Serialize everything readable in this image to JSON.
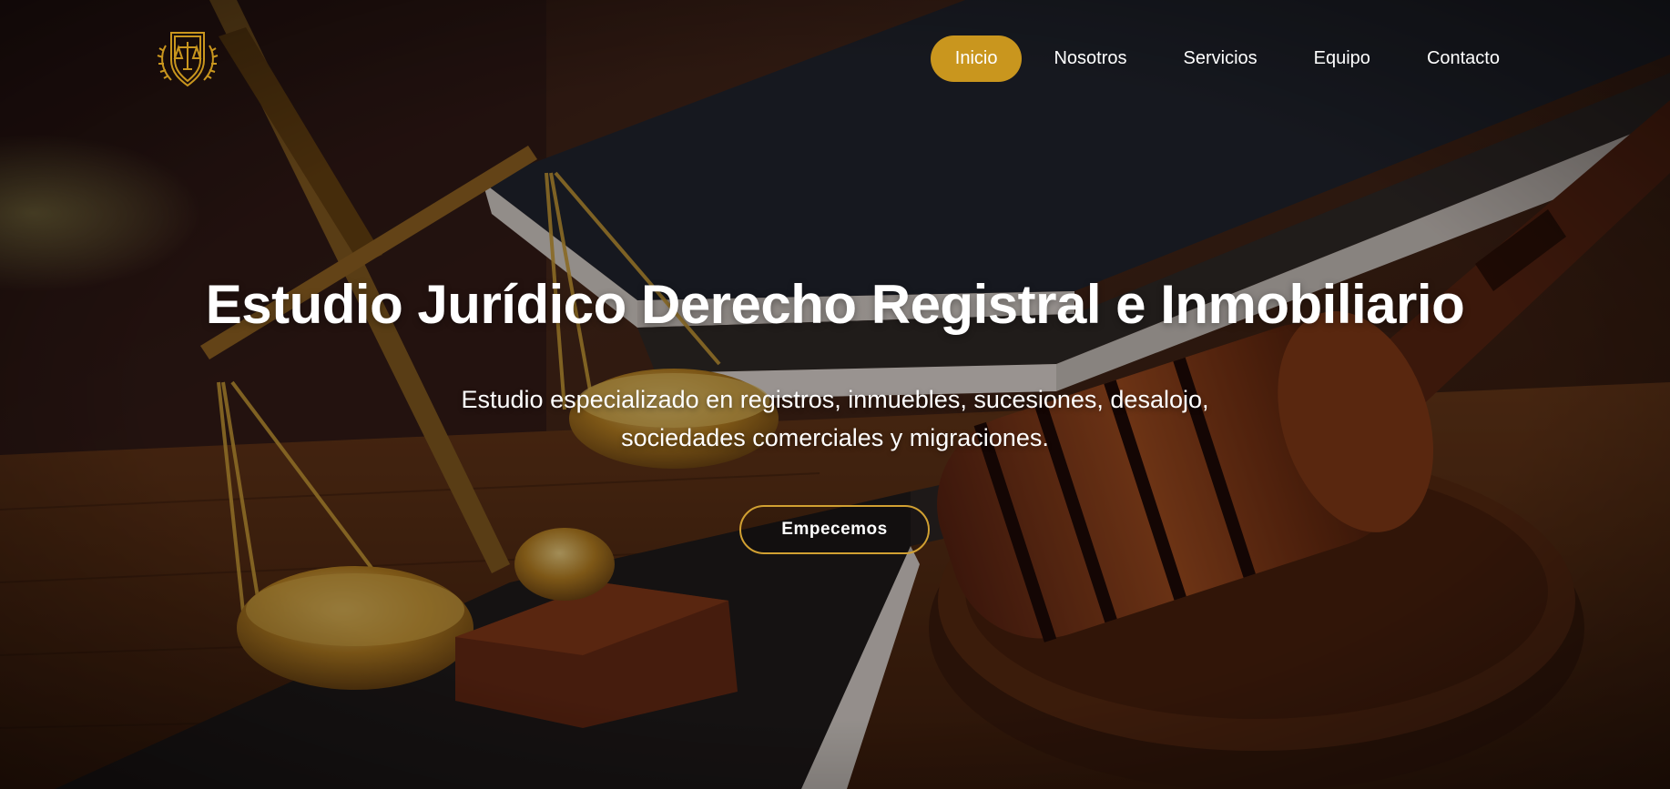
{
  "brand": {
    "logo_icon": "scales-of-justice-shield-icon",
    "accent_color": "#c9961e"
  },
  "nav": {
    "items": [
      {
        "label": "Inicio",
        "active": true
      },
      {
        "label": "Nosotros",
        "active": false
      },
      {
        "label": "Servicios",
        "active": false
      },
      {
        "label": "Equipo",
        "active": false
      },
      {
        "label": "Contacto",
        "active": false
      }
    ]
  },
  "hero": {
    "title": "Estudio Jurídico Derecho Registral e Inmobiliario",
    "subtitle_line1": "Estudio especializado en registros, inmuebles, sucesiones, desalojo,",
    "subtitle_line2": "sociedades comerciales y migraciones.",
    "cta_label": "Empecemos",
    "cta_border_color": "#d1a032",
    "background_image": "scales-of-justice-books-gavel-photo"
  }
}
